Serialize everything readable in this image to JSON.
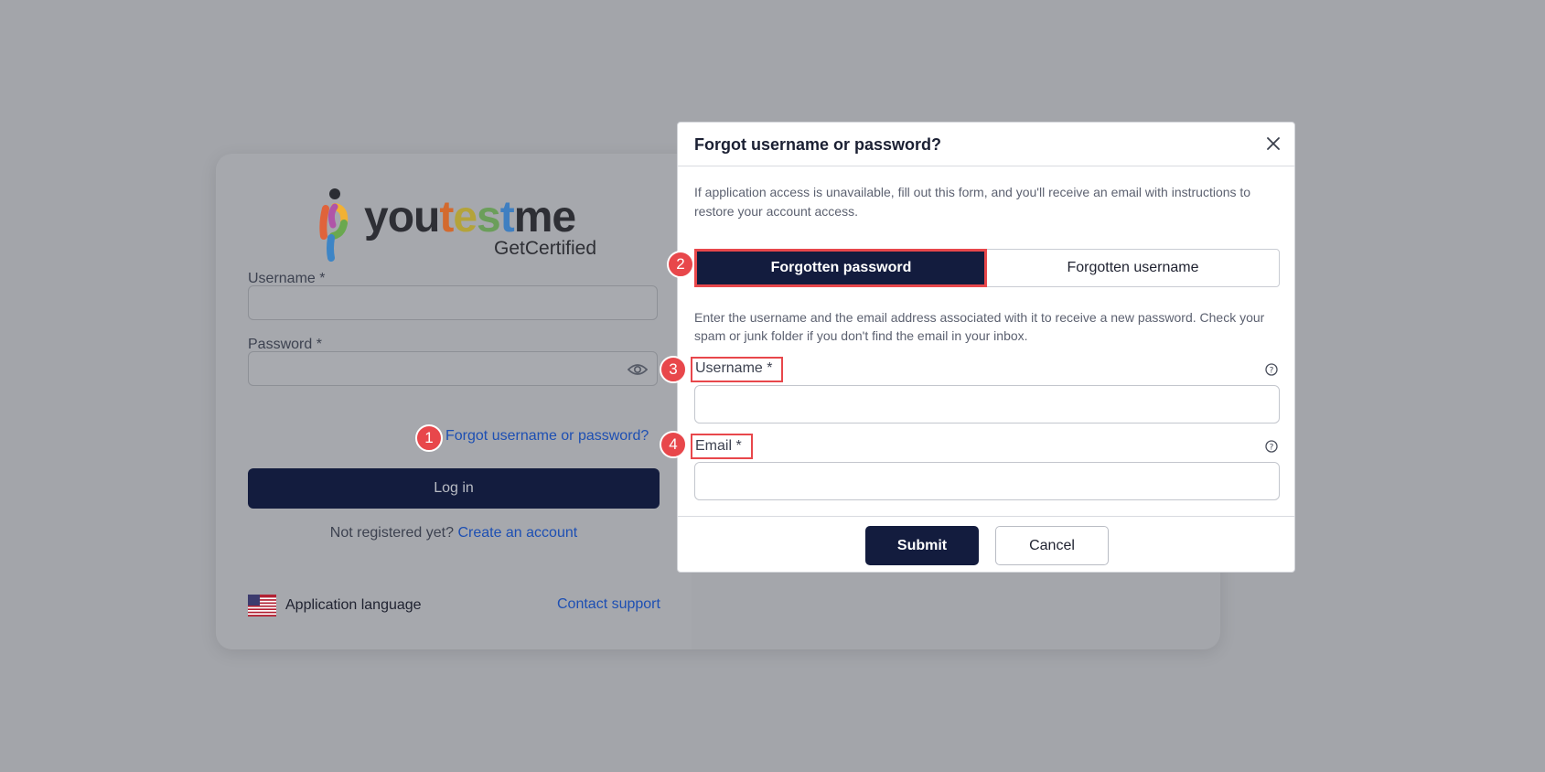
{
  "colors": {
    "overlay": "#a3a5aa",
    "primary": "#131c3e",
    "link": "#1d4fb3",
    "annotation": "#e8474b"
  },
  "login": {
    "logo_text": "youtestme",
    "logo_sub": "GetCertified",
    "username_label": "Username *",
    "password_label": "Password *",
    "forgot_link": "Forgot username or password?",
    "login_button": "Log in",
    "not_registered": "Not registered yet?",
    "create_account": "Create an account",
    "language_label": "Application language",
    "contact_support": "Contact support"
  },
  "modal": {
    "title": "Forgot username or password?",
    "intro": "If application access is unavailable, fill out this form, and you'll receive an email with instructions to restore your account access.",
    "tabs": [
      {
        "label": "Forgotten password",
        "active": true
      },
      {
        "label": "Forgotten username",
        "active": false
      }
    ],
    "note": "Enter the username and the email address associated with it to receive a new password. Check your spam or junk folder if you don't find the email in your inbox.",
    "username_label": "Username *",
    "email_label": "Email *",
    "username_value": "",
    "email_value": "",
    "submit": "Submit",
    "cancel": "Cancel"
  },
  "markers": [
    "1",
    "2",
    "3",
    "4"
  ]
}
